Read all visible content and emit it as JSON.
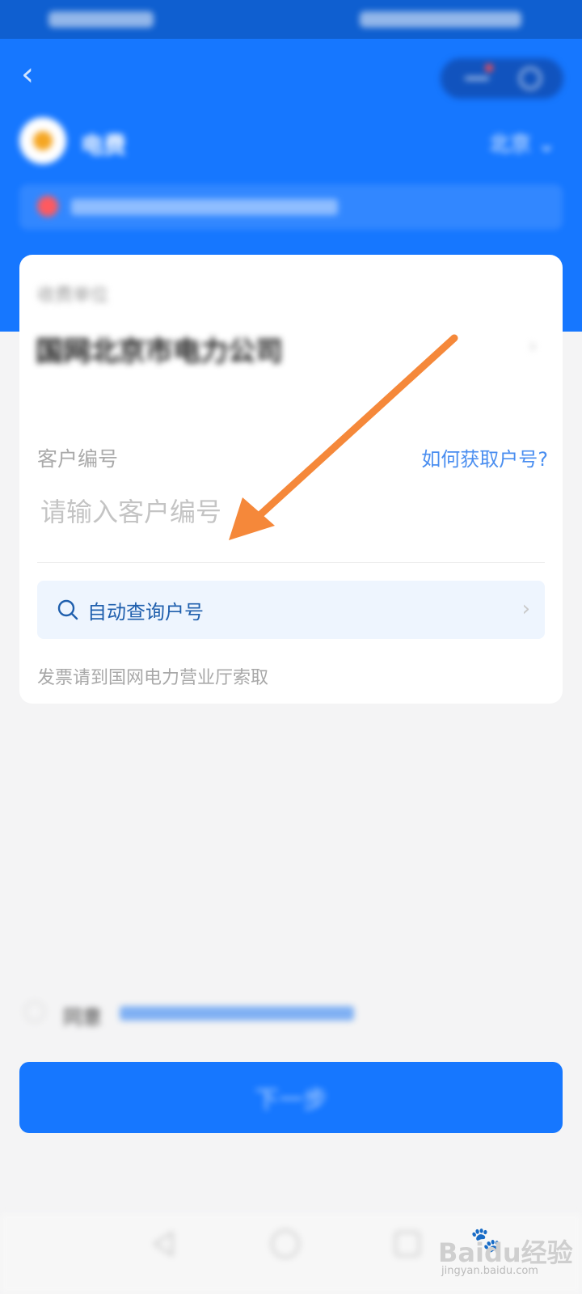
{
  "colors": {
    "accent": "#1677ff",
    "link": "#4a8ef0",
    "query_bg": "#eef5fe"
  },
  "header": {
    "utility_name": "电费",
    "city": "北京"
  },
  "form": {
    "company_label": "收费单位",
    "company_name": "国网北京市电力公司",
    "customer_label": "客户编号",
    "how_link": "如何获取户号?",
    "customer_placeholder": "请输入客户编号",
    "auto_query_label": "自动查询户号",
    "invoice_note": "发票请到国网电力营业厅索取"
  },
  "footer": {
    "agree_prefix": "同意",
    "next_label": "下一步"
  },
  "watermark": {
    "brand": "Bai",
    "brand2": "du",
    "cn": "经验",
    "url": "jingyan.baidu.com"
  }
}
